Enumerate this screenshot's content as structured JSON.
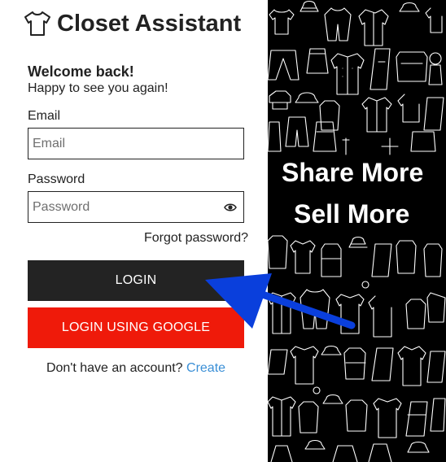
{
  "brand": {
    "title": "Closet Assistant",
    "icon": "shirt-icon"
  },
  "welcome": {
    "title": "Welcome back!",
    "subtitle": "Happy to see you again!"
  },
  "form": {
    "email_label": "Email",
    "email_placeholder": "Email",
    "email_value": "",
    "password_label": "Password",
    "password_placeholder": "Password",
    "password_value": "",
    "password_toggle_icon": "eye-icon",
    "forgot_password": "Forgot password?",
    "login_label": "LOGIN",
    "google_login_label": "LOGIN USING GOOGLE"
  },
  "signup": {
    "prompt": "Don't have an account?",
    "link_label": "Create"
  },
  "promo": {
    "line1": "Share More",
    "line2": "Sell More"
  },
  "colors": {
    "text": "#222222",
    "login_button": "#232323",
    "google_button": "#ef1a0a",
    "link": "#3a8fd6",
    "promo_background": "#000000",
    "annotation_arrow": "#0a3fdc"
  }
}
